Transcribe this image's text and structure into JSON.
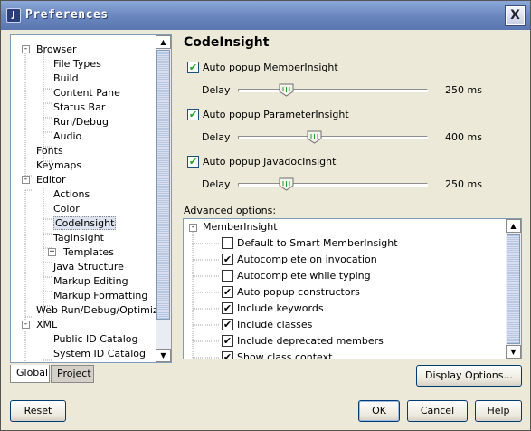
{
  "window": {
    "title": "Preferences",
    "close_glyph": "X",
    "app_icon_glyph": "J"
  },
  "tree": {
    "items": [
      {
        "label": "Browser",
        "expander": "-"
      },
      {
        "label": "File Types"
      },
      {
        "label": "Build"
      },
      {
        "label": "Content Pane"
      },
      {
        "label": "Status Bar"
      },
      {
        "label": "Run/Debug"
      },
      {
        "label": "Audio"
      },
      {
        "label": "Fonts"
      },
      {
        "label": "Keymaps"
      },
      {
        "label": "Editor",
        "expander": "-"
      },
      {
        "label": "Actions"
      },
      {
        "label": "Color"
      },
      {
        "label": "CodeInsight",
        "selected": true
      },
      {
        "label": "TagInsight"
      },
      {
        "label": "Templates",
        "expander": "+"
      },
      {
        "label": "Java Structure"
      },
      {
        "label": "Markup Editing"
      },
      {
        "label": "Markup Formatting"
      },
      {
        "label": "Web Run/Debug/Optimize"
      },
      {
        "label": "XML",
        "expander": "-"
      },
      {
        "label": "Public ID Catalog"
      },
      {
        "label": "System ID Catalog"
      }
    ]
  },
  "tabs": {
    "global": "Global",
    "project": "Project"
  },
  "codeinsight": {
    "title": "CodeInsight",
    "popups": [
      {
        "label": "Auto popup MemberInsight",
        "checked": true,
        "delay_label": "Delay",
        "delay_value": "250 ms",
        "slider_level": 0.25
      },
      {
        "label": "Auto popup ParameterInsight",
        "checked": true,
        "delay_label": "Delay",
        "delay_value": "400 ms",
        "slider_level": 0.4
      },
      {
        "label": "Auto popup JavadocInsight",
        "checked": true,
        "delay_label": "Delay",
        "delay_value": "250 ms",
        "slider_level": 0.25
      }
    ],
    "advanced_label": "Advanced options:",
    "advanced": {
      "group": "MemberInsight",
      "group_expander": "-",
      "options": [
        {
          "label": "Default to Smart MemberInsight",
          "checked": false
        },
        {
          "label": "Autocomplete on invocation",
          "checked": true
        },
        {
          "label": "Autocomplete while typing",
          "checked": false
        },
        {
          "label": "Auto popup constructors",
          "checked": true
        },
        {
          "label": "Include keywords",
          "checked": true
        },
        {
          "label": "Include classes",
          "checked": true
        },
        {
          "label": "Include deprecated members",
          "checked": true
        },
        {
          "label": "Show class context",
          "checked": true
        }
      ]
    },
    "display_options": "Display Options..."
  },
  "buttons": {
    "reset": "Reset",
    "ok": "OK",
    "cancel": "Cancel",
    "help": "Help"
  },
  "scroll_glyphs": {
    "up": "▲",
    "down": "▼"
  },
  "check_glyph": "✔",
  "colors": {
    "titlebar": "#6b87c0",
    "panel_bg": "#ece9d8",
    "border": "#7f9db9",
    "check": "#21a121"
  }
}
